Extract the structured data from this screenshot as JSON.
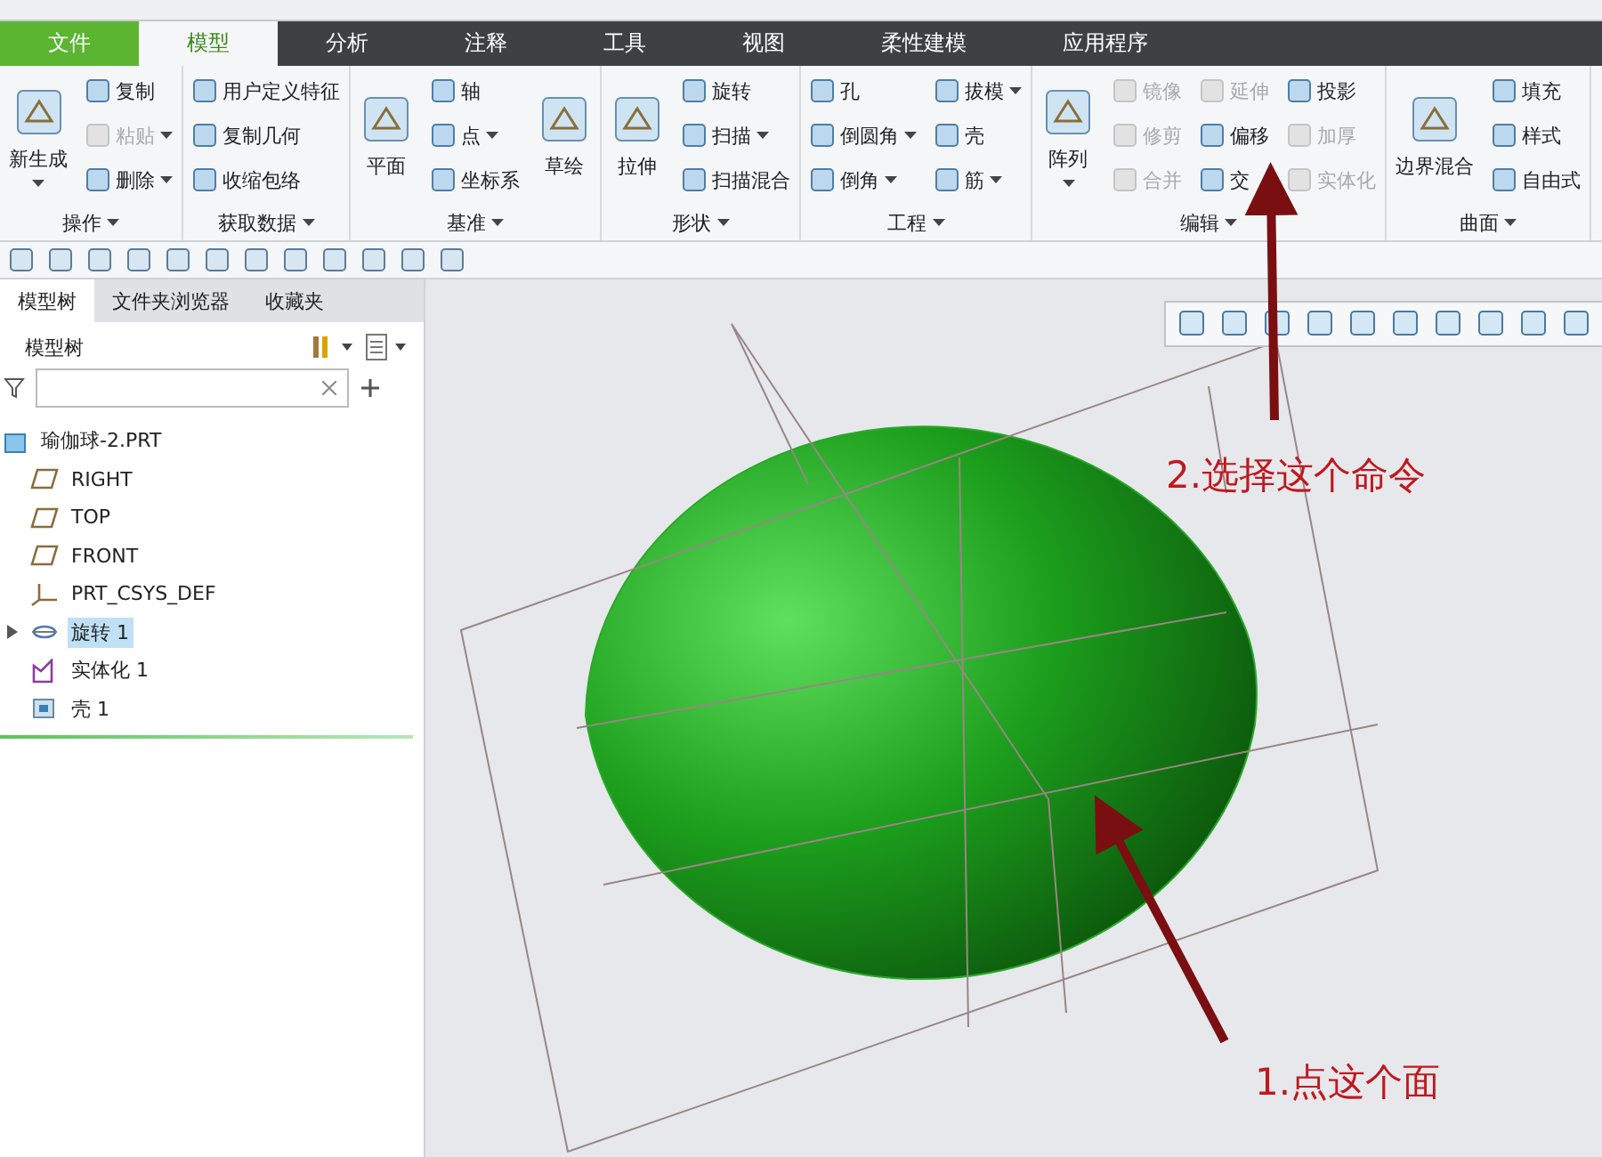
{
  "tabs": [
    {
      "label": "文件",
      "kind": "file",
      "selected": false
    },
    {
      "label": "模型",
      "kind": "tab",
      "selected": true
    },
    {
      "label": "分析",
      "kind": "tab",
      "selected": false
    },
    {
      "label": "注释",
      "kind": "tab",
      "selected": false
    },
    {
      "label": "工具",
      "kind": "tab",
      "selected": false
    },
    {
      "label": "视图",
      "kind": "tab",
      "selected": false
    },
    {
      "label": "柔性建模",
      "kind": "tab",
      "selected": false
    },
    {
      "label": "应用程序",
      "kind": "tab",
      "selected": false
    }
  ],
  "ribbon": [
    {
      "label": "操作",
      "columns": [
        [
          {
            "label": "新生成",
            "kind": "large",
            "disabled": false,
            "dropdown": true
          }
        ],
        [
          {
            "label": "复制",
            "kind": "small",
            "disabled": false,
            "dropdown": false
          },
          {
            "label": "粘贴",
            "kind": "small",
            "disabled": true,
            "dropdown": true
          },
          {
            "label": "删除",
            "kind": "small",
            "disabled": false,
            "dropdown": true
          }
        ]
      ]
    },
    {
      "label": "获取数据",
      "columns": [
        [
          {
            "label": "用户定义特征",
            "kind": "small",
            "disabled": false,
            "dropdown": false
          },
          {
            "label": "复制几何",
            "kind": "small",
            "disabled": false,
            "dropdown": false
          },
          {
            "label": "收缩包络",
            "kind": "small",
            "disabled": false,
            "dropdown": false
          }
        ]
      ]
    },
    {
      "label": "基准",
      "columns": [
        [
          {
            "label": "平面",
            "kind": "large",
            "disabled": false,
            "dropdown": false
          }
        ],
        [
          {
            "label": "轴",
            "kind": "small",
            "disabled": false,
            "dropdown": false
          },
          {
            "label": "点",
            "kind": "small",
            "disabled": false,
            "dropdown": true
          },
          {
            "label": "坐标系",
            "kind": "small",
            "disabled": false,
            "dropdown": false
          }
        ],
        [
          {
            "label": "草绘",
            "kind": "large",
            "disabled": false,
            "dropdown": false
          }
        ]
      ]
    },
    {
      "label": "形状",
      "columns": [
        [
          {
            "label": "拉伸",
            "kind": "large",
            "disabled": false,
            "dropdown": false
          }
        ],
        [
          {
            "label": "旋转",
            "kind": "small",
            "disabled": false,
            "dropdown": false
          },
          {
            "label": "扫描",
            "kind": "small",
            "disabled": false,
            "dropdown": true
          },
          {
            "label": "扫描混合",
            "kind": "small",
            "disabled": false,
            "dropdown": false
          }
        ]
      ]
    },
    {
      "label": "工程",
      "columns": [
        [
          {
            "label": "孔",
            "kind": "small",
            "disabled": false,
            "dropdown": false
          },
          {
            "label": "倒圆角",
            "kind": "small",
            "disabled": false,
            "dropdown": true
          },
          {
            "label": "倒角",
            "kind": "small",
            "disabled": false,
            "dropdown": true
          }
        ],
        [
          {
            "label": "拔模",
            "kind": "small",
            "disabled": false,
            "dropdown": true
          },
          {
            "label": "壳",
            "kind": "small",
            "disabled": false,
            "dropdown": false
          },
          {
            "label": "筋",
            "kind": "small",
            "disabled": false,
            "dropdown": true
          }
        ]
      ]
    },
    {
      "label": "编辑",
      "columns": [
        [
          {
            "label": "阵列",
            "kind": "large",
            "disabled": false,
            "dropdown": true
          }
        ],
        [
          {
            "label": "镜像",
            "kind": "small",
            "disabled": true,
            "dropdown": false
          },
          {
            "label": "修剪",
            "kind": "small",
            "disabled": true,
            "dropdown": false
          },
          {
            "label": "合并",
            "kind": "small",
            "disabled": true,
            "dropdown": false
          }
        ],
        [
          {
            "label": "延伸",
            "kind": "small",
            "disabled": true,
            "dropdown": false
          },
          {
            "label": "偏移",
            "kind": "small",
            "disabled": false,
            "dropdown": false
          },
          {
            "label": "交",
            "kind": "small",
            "disabled": false,
            "dropdown": false
          }
        ],
        [
          {
            "label": "投影",
            "kind": "small",
            "disabled": false,
            "dropdown": false
          },
          {
            "label": "加厚",
            "kind": "small",
            "disabled": true,
            "dropdown": false
          },
          {
            "label": "实体化",
            "kind": "small",
            "disabled": true,
            "dropdown": false
          }
        ]
      ]
    },
    {
      "label": "曲面",
      "columns": [
        [
          {
            "label": "边界混合",
            "kind": "large",
            "disabled": false,
            "dropdown": false
          }
        ],
        [
          {
            "label": "填充",
            "kind": "small",
            "disabled": false,
            "dropdown": false
          },
          {
            "label": "样式",
            "kind": "small",
            "disabled": false,
            "dropdown": false
          },
          {
            "label": "自由式",
            "kind": "small",
            "disabled": false,
            "dropdown": false
          }
        ]
      ]
    }
  ],
  "panel_tabs": [
    {
      "label": "模型树",
      "selected": true
    },
    {
      "label": "文件夹浏览器",
      "selected": false
    },
    {
      "label": "收藏夹",
      "selected": false
    }
  ],
  "tree_title": "模型树",
  "tree": [
    {
      "label": "瑜伽球-2.PRT",
      "kind": "part",
      "selected": false,
      "children": [
        {
          "label": "RIGHT",
          "kind": "plane",
          "selected": false,
          "expandable": false
        },
        {
          "label": "TOP",
          "kind": "plane",
          "selected": false,
          "expandable": false
        },
        {
          "label": "FRONT",
          "kind": "plane",
          "selected": false,
          "expandable": false
        },
        {
          "label": "PRT_CSYS_DEF",
          "kind": "csys",
          "selected": false,
          "expandable": false
        },
        {
          "label": "旋转 1",
          "kind": "revolve",
          "selected": true,
          "expandable": true
        },
        {
          "label": "实体化 1",
          "kind": "solidify",
          "selected": false,
          "expandable": false
        },
        {
          "label": "壳 1",
          "kind": "shell",
          "selected": false,
          "expandable": false
        }
      ]
    }
  ],
  "annotations": [
    {
      "text": "2.选择这个命令"
    },
    {
      "text": "1.点这个面"
    }
  ]
}
